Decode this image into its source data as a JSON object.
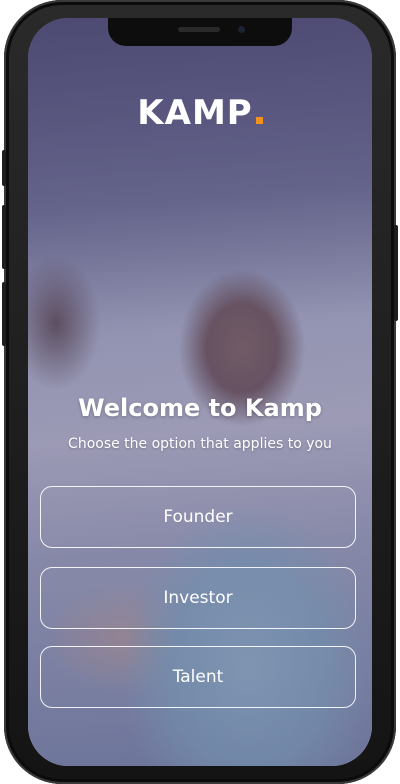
{
  "brand": {
    "logo_text": "KAMP",
    "accent_color": "#f39221"
  },
  "welcome": {
    "title": "Welcome to Kamp",
    "subtitle": "Choose the option that applies to you"
  },
  "options": [
    {
      "label": "Founder"
    },
    {
      "label": "Investor"
    },
    {
      "label": "Talent"
    }
  ],
  "icons": [
    "notch",
    "camera"
  ]
}
